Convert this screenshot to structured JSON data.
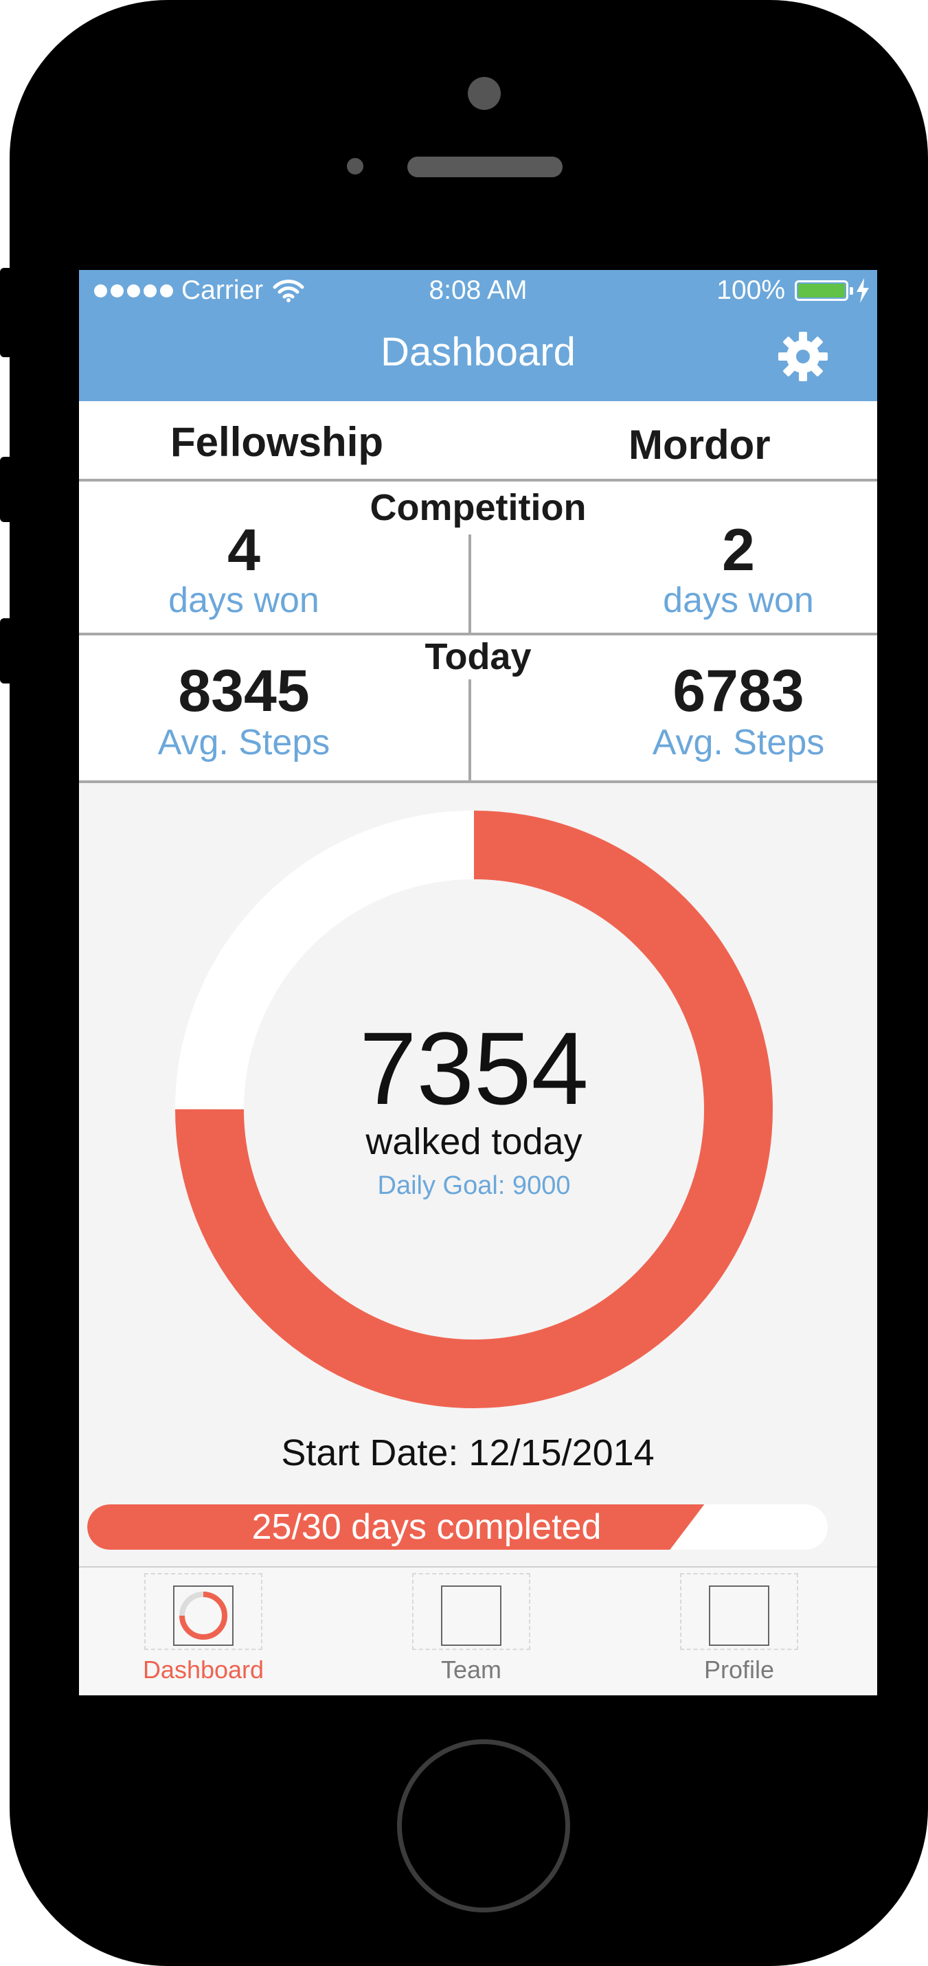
{
  "status_bar": {
    "carrier": "Carrier",
    "time": "8:08 AM",
    "battery": "100%"
  },
  "nav": {
    "title": "Dashboard",
    "settings_icon": "gear-icon"
  },
  "teams": {
    "left": "Fellowship",
    "right": "Mordor"
  },
  "competition": {
    "label": "Competition",
    "left_value": "4",
    "left_unit": "days won",
    "right_value": "2",
    "right_unit": "days won"
  },
  "today": {
    "label": "Today",
    "left_value": "8345",
    "left_unit": "Avg. Steps",
    "right_value": "6783",
    "right_unit": "Avg. Steps"
  },
  "ring": {
    "steps": "7354",
    "caption": "walked today",
    "goal_text": "Daily Goal: 9000",
    "progress_fraction": 0.75
  },
  "start_date": "Start Date: 12/15/2014",
  "progress": {
    "text": "25/30 days completed",
    "fraction": 0.8333
  },
  "tabs": [
    {
      "label": "Dashboard",
      "active": true
    },
    {
      "label": "Team",
      "active": false
    },
    {
      "label": "Profile",
      "active": false
    }
  ],
  "colors": {
    "accent_blue": "#6ba7da",
    "accent_red": "#ee6350",
    "battery_green": "#62c147"
  }
}
